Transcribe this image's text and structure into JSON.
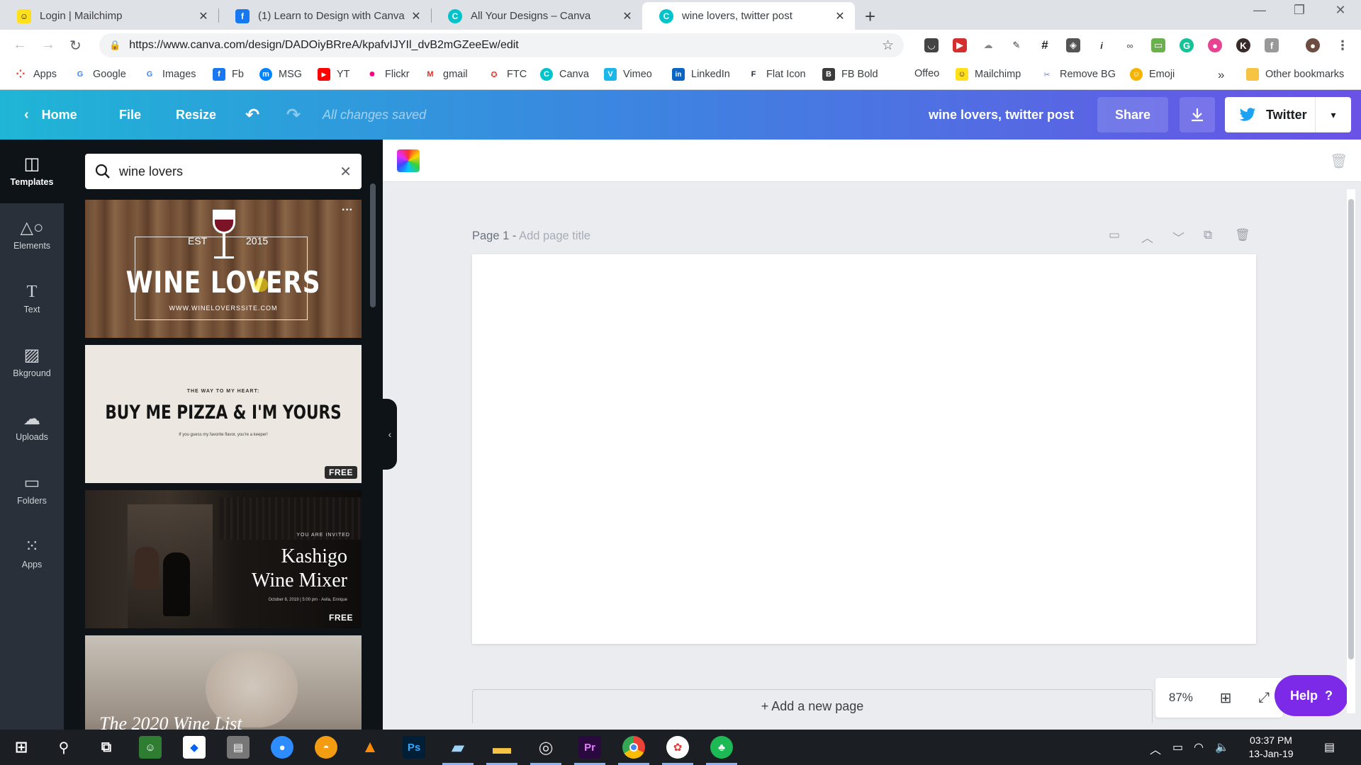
{
  "browser": {
    "tabs": [
      {
        "title": "Login | Mailchimp",
        "icon": "mailchimp-icon",
        "color": "#ffe01b",
        "glyph": "☺",
        "fg": "#241c15"
      },
      {
        "title": "(1) Learn to Design with Canva",
        "icon": "facebook-icon",
        "color": "#1877f2",
        "glyph": "f",
        "fg": "#ffffff"
      },
      {
        "title": "All Your Designs – Canva",
        "icon": "canva-icon",
        "color": "#00c4cc",
        "glyph": "C",
        "fg": "#ffffff"
      },
      {
        "title": "wine lovers, twitter post",
        "icon": "canva-icon",
        "color": "#00c4cc",
        "glyph": "C",
        "fg": "#ffffff"
      }
    ],
    "url": "https://www.canva.com/design/DADOiyBRreA/kpafvIJYIl_dvB2mGZeeEw/edit",
    "bookmarks": [
      {
        "label": "Apps",
        "color": "#4285f4",
        "glyph": "∷"
      },
      {
        "label": "Google",
        "color": "#ea4335",
        "glyph": "G"
      },
      {
        "label": "Images",
        "color": "#ea4335",
        "glyph": "G"
      },
      {
        "label": "Fb",
        "color": "#1877f2",
        "glyph": "f"
      },
      {
        "label": "MSG",
        "color": "#0084ff",
        "glyph": "m"
      },
      {
        "label": "YT",
        "color": "#ff0000",
        "glyph": "▶"
      },
      {
        "label": "Flickr",
        "color": "#ff0084",
        "glyph": "•"
      },
      {
        "label": "gmail",
        "color": "#d93025",
        "glyph": "M"
      },
      {
        "label": "FTC",
        "color": "#e53935",
        "glyph": "★"
      },
      {
        "label": "Canva",
        "color": "#00c4cc",
        "glyph": "C"
      },
      {
        "label": "Vimeo",
        "color": "#1ab7ea",
        "glyph": "V"
      },
      {
        "label": "LinkedIn",
        "color": "#0a66c2",
        "glyph": "in"
      },
      {
        "label": "Flat Icon",
        "color": "#1f2937",
        "glyph": "F"
      },
      {
        "label": "FB Bold",
        "color": "#3b3b3b",
        "glyph": "B"
      },
      {
        "label": "Offeo",
        "color": "#ffffff",
        "glyph": ""
      },
      {
        "label": "Mailchimp",
        "color": "#ffe01b",
        "glyph": "☺"
      },
      {
        "label": "Remove BG",
        "color": "#6b7fd7",
        "glyph": "✂"
      },
      {
        "label": "Emoji",
        "color": "#f5b400",
        "glyph": "☺"
      }
    ],
    "more_bookmarks": "»",
    "other_bookmarks": "Other bookmarks"
  },
  "header": {
    "home": "Home",
    "file": "File",
    "resize": "Resize",
    "saved_status": "All changes saved",
    "design_title": "wine lovers, twitter post",
    "share": "Share",
    "publish": "Twitter"
  },
  "rail": [
    {
      "label": "Templates",
      "icon": "templates-icon",
      "glyph": "◫",
      "active": true
    },
    {
      "label": "Elements",
      "icon": "elements-icon",
      "glyph": "♡",
      "active": false
    },
    {
      "label": "Text",
      "icon": "text-icon",
      "glyph": "T",
      "active": false
    },
    {
      "label": "Bkground",
      "icon": "background-icon",
      "glyph": "␥",
      "active": false
    },
    {
      "label": "Uploads",
      "icon": "uploads-icon",
      "glyph": "☁",
      "active": false
    },
    {
      "label": "Folders",
      "icon": "folders-icon",
      "glyph": "□",
      "active": false
    },
    {
      "label": "Apps",
      "icon": "apps-icon",
      "glyph": "∷",
      "active": false
    }
  ],
  "search": {
    "query": "wine lovers"
  },
  "templates": [
    {
      "est": "EST",
      "year": "2015",
      "title": "WINE LOVERS",
      "url": "WWW.WINELOVERSSITE.COM"
    },
    {
      "kicker": "THE WAY TO MY HEART:",
      "title": "BUY ME PIZZA & I'M YOURS",
      "sub": "If you guess my favorite flavor, you're a keeper!",
      "badge": "FREE"
    },
    {
      "kicker": "YOU ARE INVITED",
      "line1": "Kashigo",
      "line2": "Wine Mixer",
      "details": "October 8, 2019 | 5:00 pm · Avila, Enrique",
      "badge": "FREE"
    },
    {
      "title": "The 2020 Wine List"
    }
  ],
  "editor": {
    "page_label": "Page 1 - ",
    "page_title_placeholder": "Add page title",
    "add_page": "+ Add a new page",
    "zoom": "87%",
    "help": "Help",
    "help_glyph": "?"
  },
  "taskbar": {
    "time": "03:37 PM",
    "date": "13-Jan-19"
  }
}
